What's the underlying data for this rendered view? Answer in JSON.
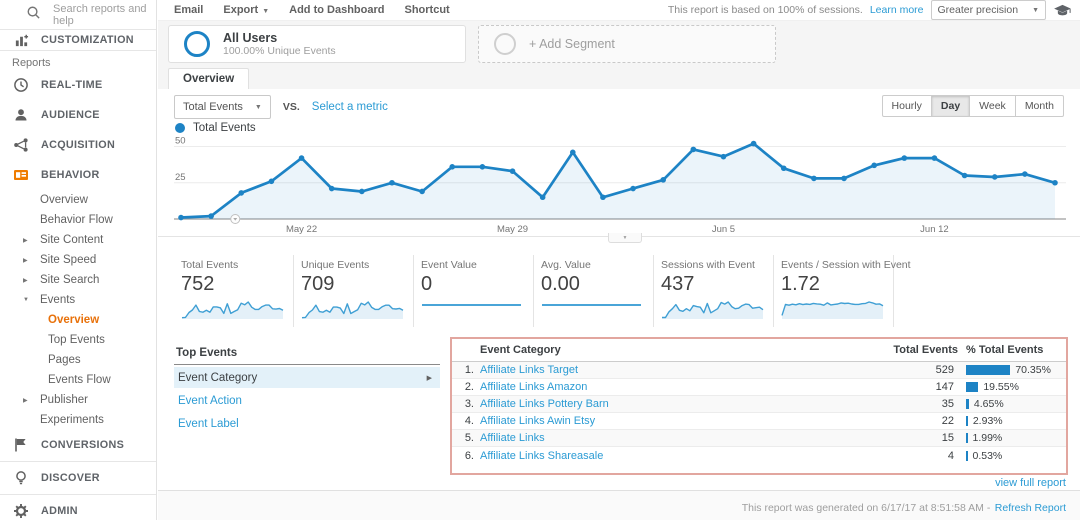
{
  "colors": {
    "accent_blue": "#1d83c5",
    "link_blue": "#2b9bd4",
    "orange": "#e8710a",
    "table_highlight_border": "#e2a69f"
  },
  "sidebar": {
    "search_placeholder": "Search reports and help",
    "customization_label": "CUSTOMIZATION",
    "reports_label": "Reports",
    "items": [
      {
        "label": "REAL-TIME",
        "icon": "clock-icon",
        "level": 0
      },
      {
        "label": "AUDIENCE",
        "icon": "person-icon",
        "level": 0
      },
      {
        "label": "ACQUISITION",
        "icon": "network-icon",
        "level": 0
      },
      {
        "label": "BEHAVIOR",
        "icon": "behavior-icon",
        "level": 0
      },
      {
        "label": "Overview",
        "level": 1
      },
      {
        "label": "Behavior Flow",
        "level": 1
      },
      {
        "label": "Site Content",
        "level": 1,
        "arrow": "right"
      },
      {
        "label": "Site Speed",
        "level": 1,
        "arrow": "right"
      },
      {
        "label": "Site Search",
        "level": 1,
        "arrow": "right"
      },
      {
        "label": "Events",
        "level": 1,
        "arrow": "down"
      },
      {
        "label": "Overview",
        "level": 2,
        "selected": true
      },
      {
        "label": "Top Events",
        "level": 2
      },
      {
        "label": "Pages",
        "level": 2
      },
      {
        "label": "Events Flow",
        "level": 2
      },
      {
        "label": "Publisher",
        "level": 1,
        "arrow": "right"
      },
      {
        "label": "Experiments",
        "level": 1
      },
      {
        "label": "CONVERSIONS",
        "icon": "flag-icon",
        "level": 0
      },
      {
        "label": "DISCOVER",
        "icon": "lightbulb-icon",
        "level": 0,
        "divider_before": true
      },
      {
        "label": "ADMIN",
        "icon": "gear-icon",
        "level": 0,
        "divider_before": true
      }
    ]
  },
  "toolbar": {
    "email": "Email",
    "export": "Export",
    "add_to_dashboard": "Add to Dashboard",
    "shortcut": "Shortcut",
    "sampling_note": "This report is based on 100% of sessions.",
    "learn_more": "Learn more",
    "precision_selector": "Greater precision"
  },
  "segments": {
    "all_users_title": "All Users",
    "all_users_subtitle": "100.00% Unique Events",
    "add_segment": "+ Add Segment"
  },
  "tab": {
    "label": "Overview"
  },
  "controls": {
    "metric_selector": "Total Events",
    "vs_label": "VS.",
    "select_metric": "Select a metric",
    "granularity": [
      "Hourly",
      "Day",
      "Week",
      "Month"
    ],
    "active_granularity": "Day",
    "legend_label": "Total Events"
  },
  "chart_data": {
    "type": "line",
    "title": "Total Events",
    "grid": true,
    "legend_position": "top-left",
    "x_range": [
      "May 18",
      "Jun 16"
    ],
    "x_tick_labels": [
      {
        "label": "May 22",
        "index": 4
      },
      {
        "label": "May 29",
        "index": 11
      },
      {
        "label": "Jun 5",
        "index": 18
      },
      {
        "label": "Jun 12",
        "index": 25
      }
    ],
    "yticks": [
      25,
      50
    ],
    "ylim": [
      0,
      57
    ],
    "series": [
      {
        "name": "Total Events",
        "color": "#1d83c5",
        "values": [
          1,
          2,
          18,
          26,
          42,
          21,
          19,
          25,
          19,
          36,
          36,
          33,
          15,
          46,
          15,
          21,
          27,
          48,
          43,
          52,
          35,
          28,
          28,
          37,
          42,
          42,
          30,
          29,
          31,
          25
        ]
      }
    ]
  },
  "metrics": [
    {
      "label": "Total Events",
      "value": "752",
      "spark": [
        1,
        2,
        18,
        26,
        42,
        21,
        19,
        25,
        19,
        36,
        36,
        33,
        15,
        46,
        15,
        21,
        27,
        48,
        43,
        52,
        35,
        28,
        28,
        37,
        42,
        42,
        30,
        29,
        31,
        25
      ]
    },
    {
      "label": "Unique Events",
      "value": "709",
      "spark": [
        1,
        2,
        17,
        25,
        40,
        20,
        18,
        24,
        18,
        34,
        34,
        31,
        14,
        44,
        14,
        20,
        26,
        46,
        41,
        50,
        33,
        27,
        27,
        35,
        40,
        40,
        29,
        28,
        30,
        24
      ]
    },
    {
      "label": "Event Value",
      "value": "0",
      "spark": [
        0,
        0,
        0,
        0,
        0,
        0,
        0,
        0,
        0,
        0,
        0,
        0,
        0,
        0,
        0,
        0,
        0,
        0,
        0,
        0,
        0,
        0,
        0,
        0,
        0,
        0,
        0,
        0,
        0,
        0
      ]
    },
    {
      "label": "Avg. Value",
      "value": "0.00",
      "spark": [
        0,
        0,
        0,
        0,
        0,
        0,
        0,
        0,
        0,
        0,
        0,
        0,
        0,
        0,
        0,
        0,
        0,
        0,
        0,
        0,
        0,
        0,
        0,
        0,
        0,
        0,
        0,
        0,
        0,
        0
      ]
    },
    {
      "label": "Sessions with Event",
      "value": "437",
      "spark": [
        1,
        1,
        12,
        18,
        26,
        15,
        13,
        18,
        14,
        24,
        22,
        21,
        10,
        28,
        10,
        14,
        18,
        30,
        27,
        31,
        22,
        18,
        19,
        24,
        27,
        26,
        19,
        20,
        21,
        16
      ]
    },
    {
      "label": "Events / Session with Event",
      "value": "1.72",
      "spark": [
        0.3,
        1.6,
        1.5,
        1.62,
        1.55,
        1.68,
        1.58,
        1.64,
        1.6,
        1.72,
        1.66,
        1.62,
        1.5,
        1.78,
        1.54,
        1.6,
        1.64,
        1.78,
        1.7,
        1.74,
        1.64,
        1.6,
        1.6,
        1.68,
        1.72,
        1.88,
        1.78,
        1.62,
        1.66,
        1.45
      ]
    }
  ],
  "top_events": {
    "title": "Top Events",
    "rows": [
      {
        "label": "Event Category",
        "selected": true
      },
      {
        "label": "Event Action",
        "selected": false
      },
      {
        "label": "Event Label",
        "selected": false
      }
    ]
  },
  "table": {
    "headers": {
      "category": "Event Category",
      "total": "Total Events",
      "pct": "% Total Events"
    },
    "rows": [
      {
        "rank": "1.",
        "category": "Affiliate Links Target",
        "total": "529",
        "pct": 70.35,
        "pct_label": "70.35%"
      },
      {
        "rank": "2.",
        "category": "Affiliate Links Amazon",
        "total": "147",
        "pct": 19.55,
        "pct_label": "19.55%"
      },
      {
        "rank": "3.",
        "category": "Affiliate Links Pottery Barn",
        "total": "35",
        "pct": 4.65,
        "pct_label": "4.65%"
      },
      {
        "rank": "4.",
        "category": "Affiliate Links Awin Etsy",
        "total": "22",
        "pct": 2.93,
        "pct_label": "2.93%"
      },
      {
        "rank": "5.",
        "category": "Affiliate Links",
        "total": "15",
        "pct": 1.99,
        "pct_label": "1.99%"
      },
      {
        "rank": "6.",
        "category": "Affiliate Links Shareasale",
        "total": "4",
        "pct": 0.53,
        "pct_label": "0.53%"
      }
    ],
    "view_full_report": "view full report"
  },
  "footer": {
    "generated_text": "This report was generated on 6/17/17 at 8:51:58 AM -",
    "refresh_link": "Refresh Report"
  }
}
